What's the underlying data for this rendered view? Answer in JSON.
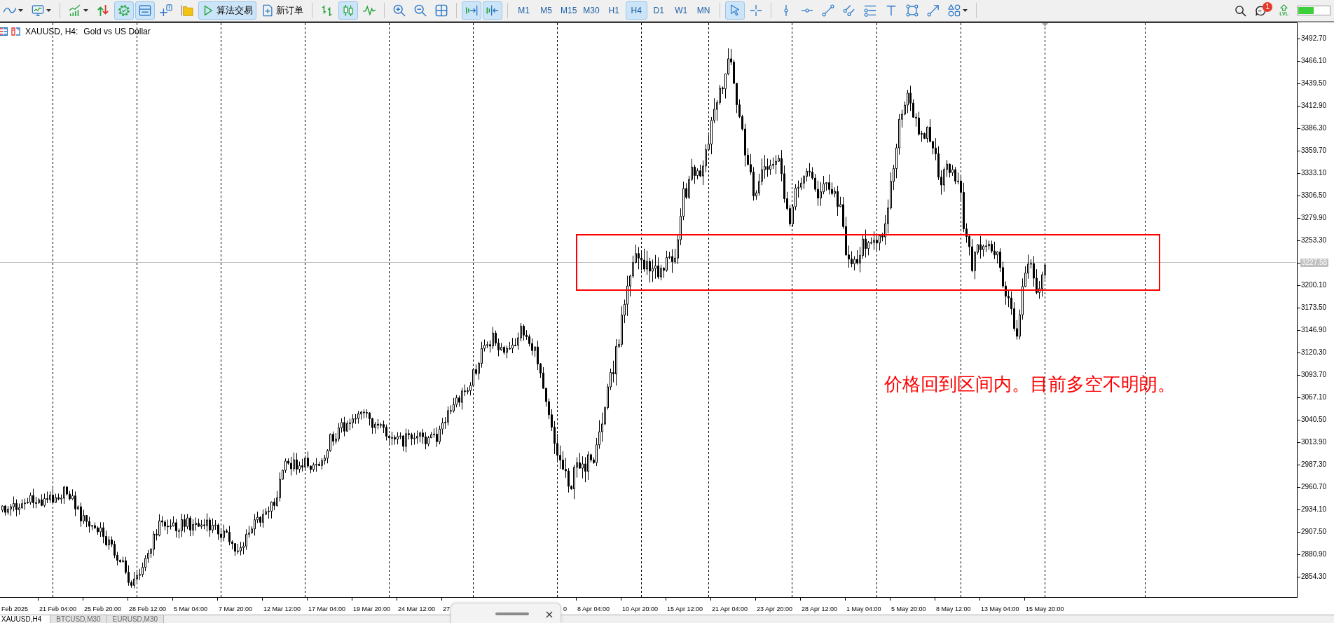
{
  "toolbar": {
    "groups": [
      [
        {
          "kind": "wave",
          "on": false,
          "dropdown": true
        },
        {
          "kind": "chart-window",
          "on": false,
          "dropdown": true
        }
      ],
      [
        {
          "kind": "indicators",
          "on": false,
          "dropdown": true
        },
        {
          "kind": "trade-arrows",
          "on": false
        },
        {
          "kind": "gear",
          "on": true
        },
        {
          "kind": "panel",
          "on": true
        },
        {
          "kind": "crosshair-info",
          "on": false
        },
        {
          "kind": "folder",
          "on": false
        },
        {
          "kind": "play",
          "on": true,
          "label": "算法交易"
        },
        {
          "kind": "new-doc",
          "on": false,
          "label": "新订单"
        }
      ],
      [
        {
          "kind": "ohlc",
          "on": false
        },
        {
          "kind": "candles",
          "on": true
        },
        {
          "kind": "zigzag",
          "on": false
        }
      ],
      [
        {
          "kind": "zoom-in",
          "on": false
        },
        {
          "kind": "zoom-out",
          "on": false
        },
        {
          "kind": "grid",
          "on": false
        }
      ],
      [
        {
          "kind": "scroll-end",
          "on": true
        },
        {
          "kind": "shift",
          "on": true
        }
      ]
    ],
    "timeframes": [
      {
        "label": "M1",
        "selected": false
      },
      {
        "label": "M5",
        "selected": false
      },
      {
        "label": "M15",
        "selected": false
      },
      {
        "label": "M30",
        "selected": false
      },
      {
        "label": "H1",
        "selected": false
      },
      {
        "label": "H4",
        "selected": true
      },
      {
        "label": "D1",
        "selected": false
      },
      {
        "label": "W1",
        "selected": false
      },
      {
        "label": "MN",
        "selected": false
      }
    ],
    "drawing_groups": [
      [
        {
          "kind": "cursor",
          "on": true
        },
        {
          "kind": "crosshair",
          "on": false
        }
      ],
      [
        {
          "kind": "vline",
          "on": false
        },
        {
          "kind": "hline",
          "on": false
        },
        {
          "kind": "trendline",
          "on": false
        },
        {
          "kind": "channel",
          "on": false
        },
        {
          "kind": "fibo",
          "on": false
        },
        {
          "kind": "text-tool",
          "on": false
        },
        {
          "kind": "rectangle",
          "on": false
        },
        {
          "kind": "arrow-line",
          "on": false
        },
        {
          "kind": "shapes",
          "on": false,
          "dropdown": true
        }
      ]
    ],
    "messages_badge": "1",
    "level_label": "LVL"
  },
  "chart": {
    "title": {
      "symbol": "XAUUSD, H4:",
      "description": "Gold vs US Dollar"
    },
    "annotation": "价格回到区间内。目前多空不明朗。",
    "price_axis": [
      {
        "kind": "tick",
        "label": "3492.70"
      },
      {
        "kind": "tick",
        "label": "3466.10"
      },
      {
        "kind": "tick",
        "label": "3439.50"
      },
      {
        "kind": "tick",
        "label": "3412.90"
      },
      {
        "kind": "tick",
        "label": "3386.30"
      },
      {
        "kind": "tick",
        "label": "3359.70"
      },
      {
        "kind": "tick",
        "label": "3333.10"
      },
      {
        "kind": "tick",
        "label": "3306.50"
      },
      {
        "kind": "tick",
        "label": "3279.90"
      },
      {
        "kind": "tick",
        "label": "3253.30"
      },
      {
        "kind": "current",
        "label": "3227.58"
      },
      {
        "kind": "tick",
        "label": "3200.10"
      },
      {
        "kind": "tick",
        "label": "3173.50"
      },
      {
        "kind": "tick",
        "label": "3146.90"
      },
      {
        "kind": "tick",
        "label": "3120.30"
      },
      {
        "kind": "tick",
        "label": "3093.70"
      },
      {
        "kind": "tick",
        "label": "3067.10"
      },
      {
        "kind": "tick",
        "label": "3040.50"
      },
      {
        "kind": "tick",
        "label": "3013.90"
      },
      {
        "kind": "tick",
        "label": "2987.30"
      },
      {
        "kind": "tick",
        "label": "2960.70"
      },
      {
        "kind": "tick",
        "label": "2934.10"
      },
      {
        "kind": "tick",
        "label": "2907.50"
      },
      {
        "kind": "tick",
        "label": "2880.90"
      },
      {
        "kind": "tick",
        "label": "2854.30"
      }
    ],
    "time_axis": [
      "Feb 2025",
      "21 Feb 04:00",
      "25 Feb 20:00",
      "28 Feb 12:00",
      "5 Mar 04:00",
      "7 Mar 20:00",
      "12 Mar 12:00",
      "17 Mar 04:00",
      "19 Mar 20:00",
      "24 Mar 12:00",
      "27",
      "0",
      "8 Apr 04:00",
      "10 Apr 20:00",
      "15 Apr 12:00",
      "21 Apr 04:00",
      "23 Apr 20:00",
      "28 Apr 12:00",
      "1 May 04:00",
      "5 May 20:00",
      "8 May 12:00",
      "13 May 04:00",
      "15 May 20:00"
    ]
  },
  "chart_tabs": [
    {
      "label": "XAUUSD,H4",
      "selected": true
    },
    {
      "label": "BTCUSD,M30",
      "selected": false
    },
    {
      "label": "EURUSD,M30",
      "selected": false
    }
  ]
}
